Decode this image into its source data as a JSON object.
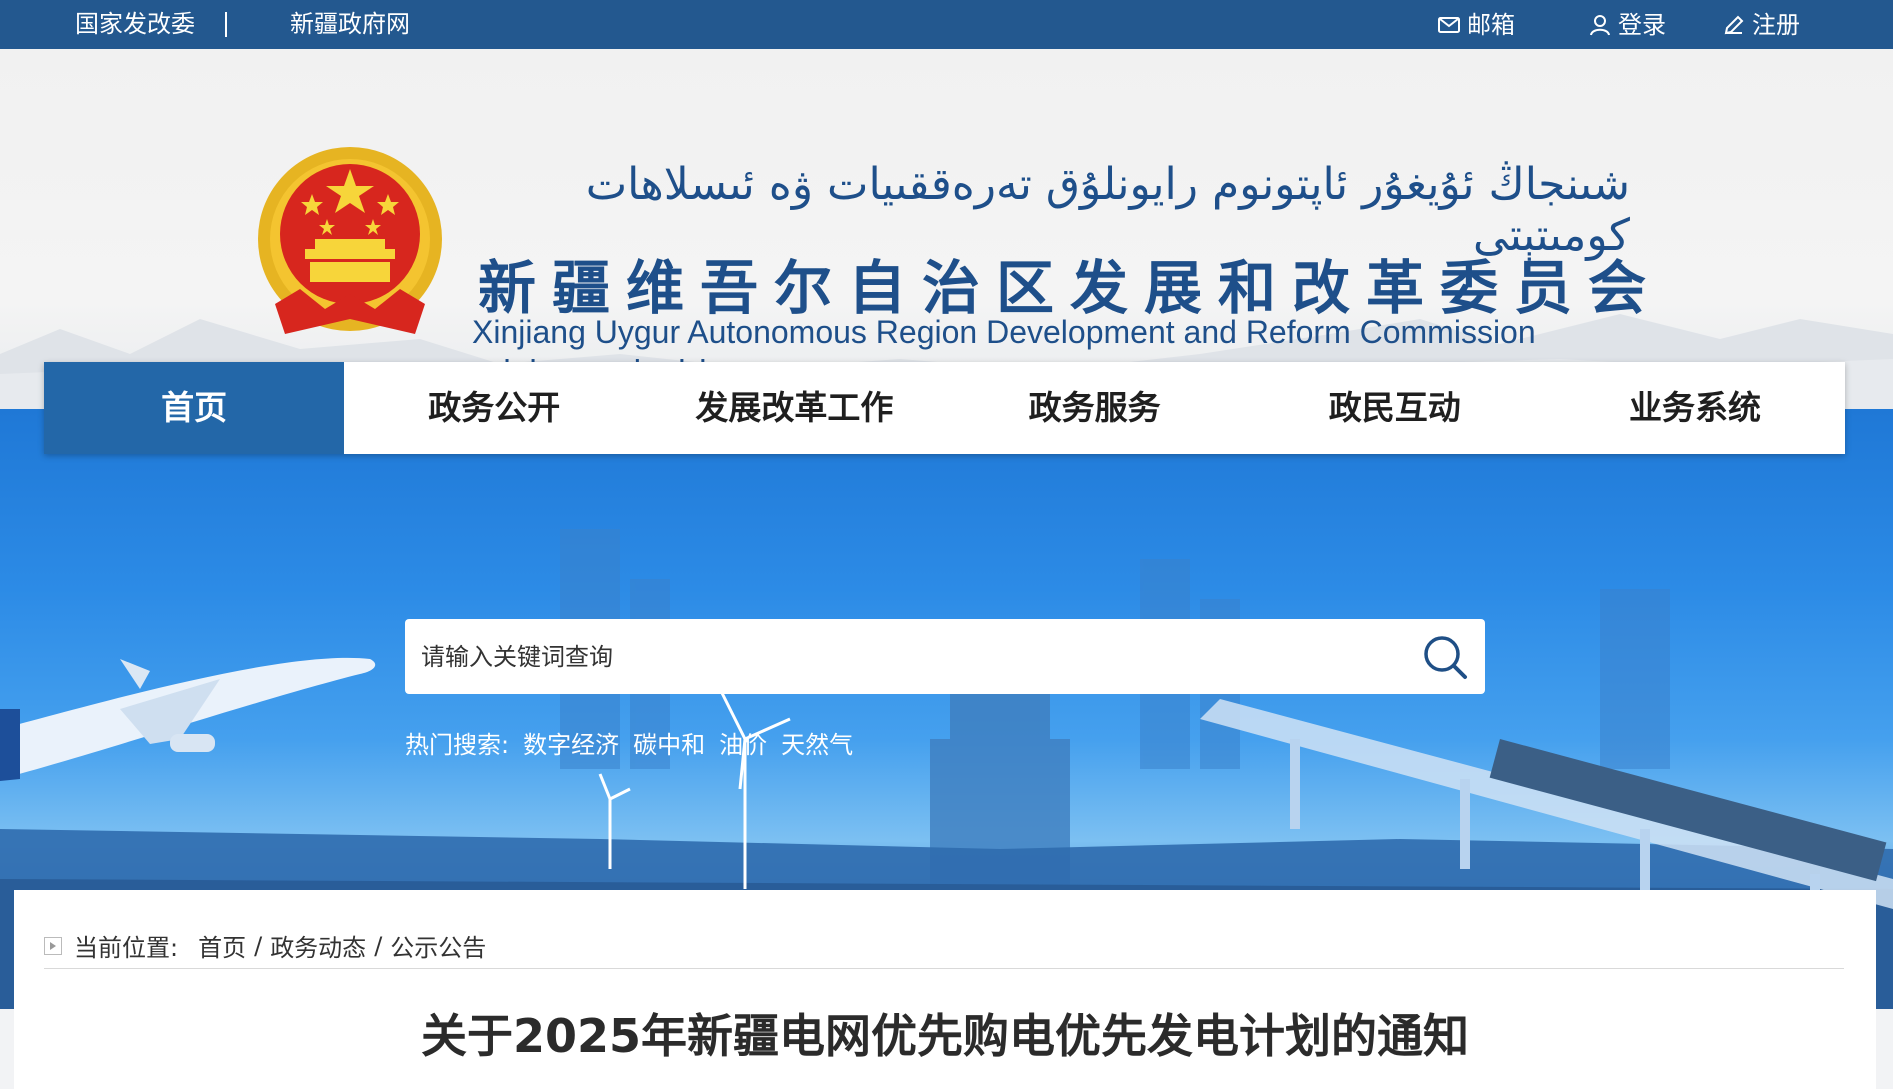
{
  "topbar": {
    "links": [
      "国家发改委",
      "新疆政府网"
    ],
    "mail": "邮箱",
    "login": "登录",
    "register": "注册"
  },
  "header": {
    "uyghur_title": "شىنجاڭ ئۇيغۇر ئاپتونوم رايونلۇق تەرەققىيات ۋە ئىسلاھات كومىتېتى",
    "cn_title": "新疆维吾尔自治区发展和改革委员会",
    "en_title": "Xinjiang Uygur Autonomous Region Development and Reform Commission",
    "domain": "xjdrc.xinjiang.gov.cn"
  },
  "nav": {
    "items": [
      "首页",
      "政务公开",
      "发展改革工作",
      "政务服务",
      "政民互动",
      "业务系统"
    ],
    "active": "首页"
  },
  "search": {
    "placeholder": "请输入关键词查询",
    "hot_label": "热门搜索:",
    "hot_terms": [
      "数字经济",
      "碳中和",
      "油价",
      "天然气"
    ]
  },
  "breadcrumb": {
    "label": "当前位置:",
    "items": [
      "首页",
      "政务动态",
      "公示公告"
    ]
  },
  "article": {
    "title": "关于2025年新疆电网优先购电优先发电计划的通知"
  },
  "colors": {
    "topbar": "#23588f",
    "brand_text": "#1e4f8a",
    "nav_active": "#2367a8"
  },
  "icons": [
    "mail-icon",
    "user-icon",
    "pencil-icon",
    "search-icon",
    "national-emblem",
    "breadcrumb-icon"
  ]
}
